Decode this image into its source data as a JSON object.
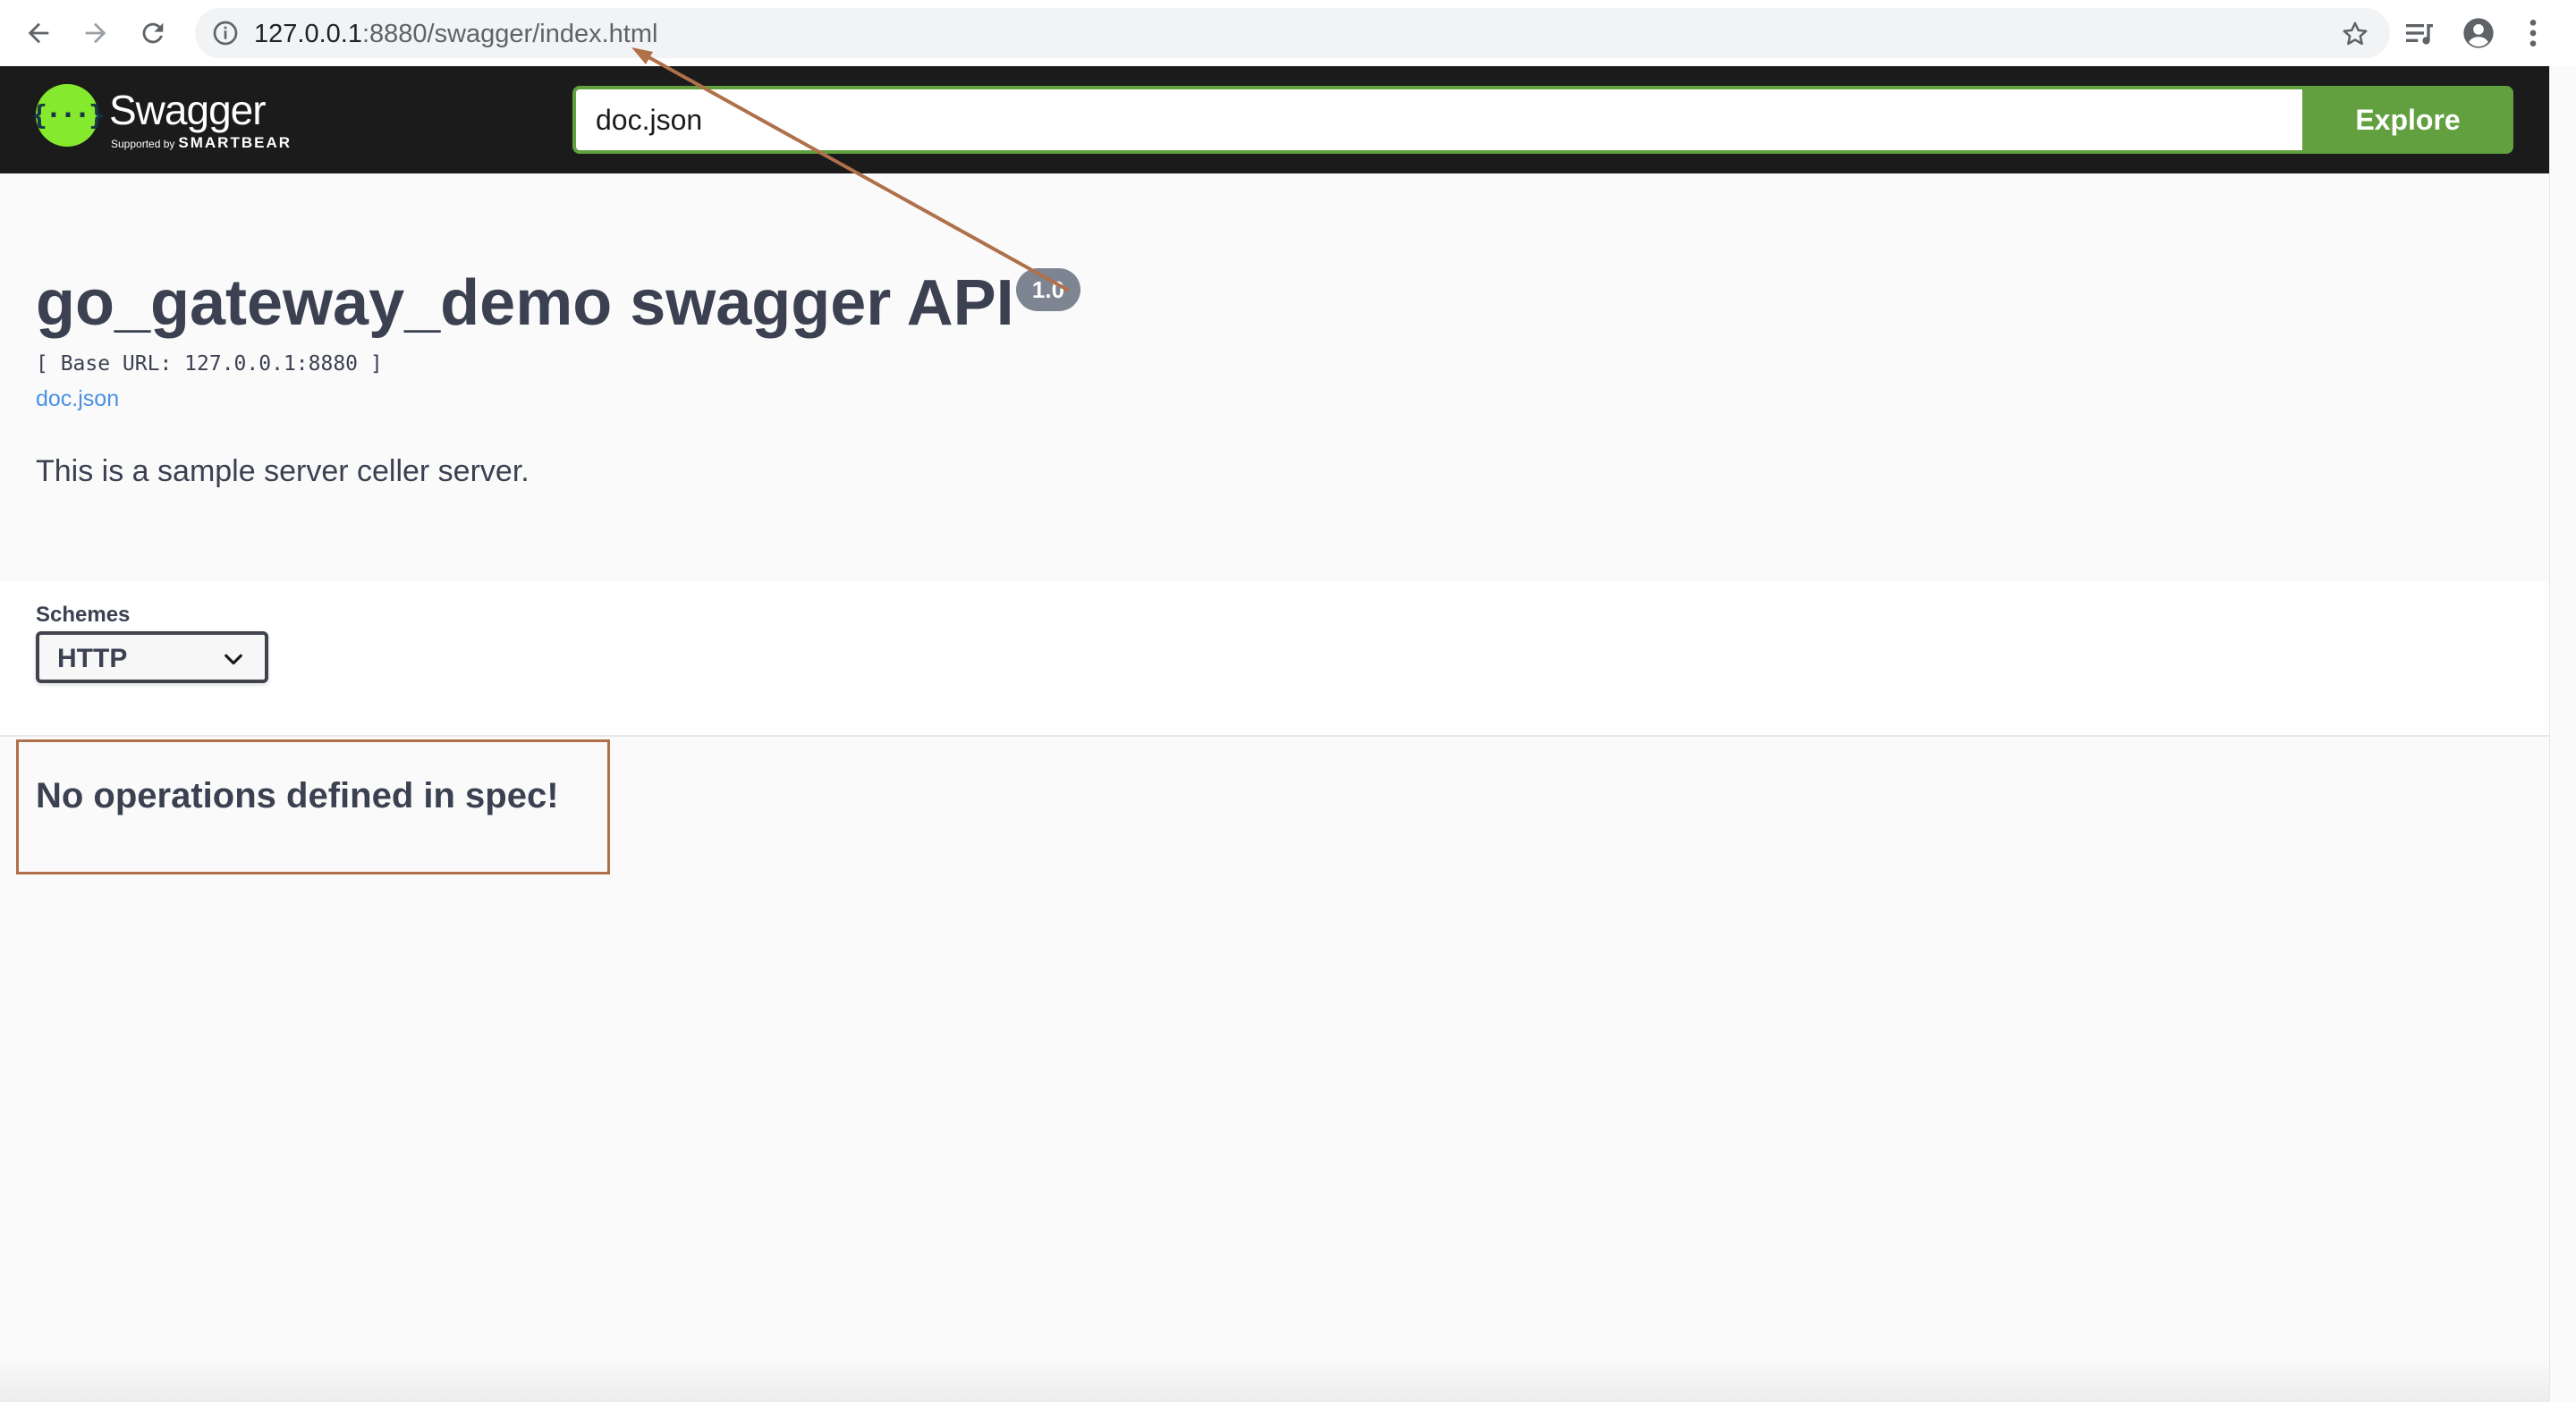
{
  "browser": {
    "url_host": "127.0.0.1",
    "url_path": ":8880/swagger/index.html"
  },
  "topbar": {
    "brand": "Swagger",
    "brand_sub_prefix": "Supported by",
    "brand_sub_name": "SMARTBEAR",
    "spec_url_value": "doc.json",
    "explore_label": "Explore"
  },
  "info": {
    "title": "go_gateway_demo swagger API",
    "version": "1.0",
    "base_url": "[ Base URL: 127.0.0.1:8880 ]",
    "spec_link": "doc.json",
    "description": "This is a sample server celler server."
  },
  "schemes": {
    "label": "Schemes",
    "selected": "HTTP"
  },
  "operations": {
    "empty_message": "No operations defined in spec!"
  },
  "colors": {
    "topbar_bg": "#1b1b1b",
    "accent_green": "#62a03f",
    "logo_green": "#85ea2d",
    "link_blue": "#4990e2",
    "annotation": "#b0704a",
    "badge_gray": "#7d8492"
  },
  "icons": [
    "back-arrow-icon",
    "forward-arrow-icon",
    "reload-icon",
    "info-icon",
    "star-icon",
    "reading-list-icon",
    "account-icon",
    "menu-dots-icon",
    "chevron-down-icon"
  ]
}
